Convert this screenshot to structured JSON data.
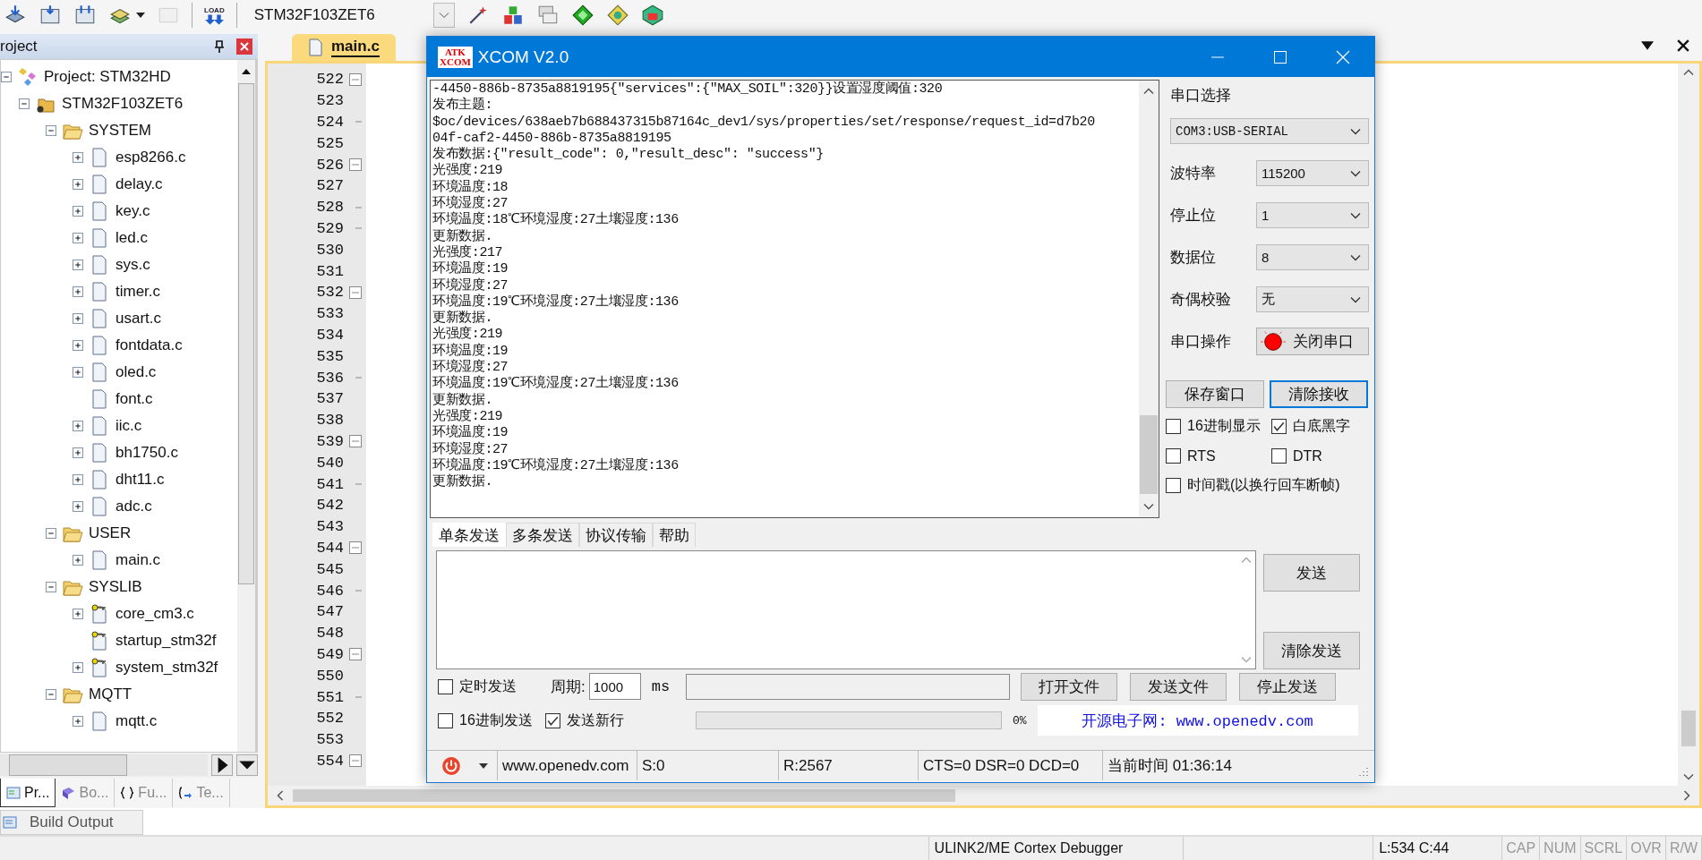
{
  "toolbar": {
    "load_label": "LOAD",
    "target": "STM32F103ZET6"
  },
  "project_panel": {
    "title": "roject",
    "tree": [
      {
        "label": "Project: STM32HD",
        "kind": "project",
        "expanded": true,
        "children": [
          {
            "label": "STM32F103ZET6",
            "kind": "target",
            "expanded": true,
            "children": [
              {
                "label": "SYSTEM",
                "kind": "group",
                "expanded": true,
                "children": [
                  {
                    "label": "esp8266.c",
                    "kind": "file",
                    "expanded": false
                  },
                  {
                    "label": "delay.c",
                    "kind": "file",
                    "expanded": false
                  },
                  {
                    "label": "key.c",
                    "kind": "file",
                    "expanded": false
                  },
                  {
                    "label": "led.c",
                    "kind": "file",
                    "expanded": false
                  },
                  {
                    "label": "sys.c",
                    "kind": "file",
                    "expanded": false
                  },
                  {
                    "label": "timer.c",
                    "kind": "file",
                    "expanded": false
                  },
                  {
                    "label": "usart.c",
                    "kind": "file",
                    "expanded": false
                  },
                  {
                    "label": "fontdata.c",
                    "kind": "file",
                    "expanded": false
                  },
                  {
                    "label": "oled.c",
                    "kind": "file",
                    "expanded": false
                  },
                  {
                    "label": "font.c",
                    "kind": "file"
                  },
                  {
                    "label": "iic.c",
                    "kind": "file",
                    "expanded": false
                  },
                  {
                    "label": "bh1750.c",
                    "kind": "file",
                    "expanded": false
                  },
                  {
                    "label": "dht11.c",
                    "kind": "file",
                    "expanded": false
                  },
                  {
                    "label": "adc.c",
                    "kind": "file",
                    "expanded": false
                  }
                ]
              },
              {
                "label": "USER",
                "kind": "group",
                "expanded": true,
                "children": [
                  {
                    "label": "main.c",
                    "kind": "file",
                    "expanded": false
                  }
                ]
              },
              {
                "label": "SYSLIB",
                "kind": "group",
                "expanded": true,
                "children": [
                  {
                    "label": "core_cm3.c",
                    "kind": "lib",
                    "expanded": false
                  },
                  {
                    "label": "startup_stm32f",
                    "kind": "lib"
                  },
                  {
                    "label": "system_stm32f",
                    "kind": "lib",
                    "expanded": false
                  }
                ]
              },
              {
                "label": "MQTT",
                "kind": "group",
                "expanded": true,
                "children": [
                  {
                    "label": "mqtt.c",
                    "kind": "file",
                    "expanded": false
                  }
                ]
              }
            ]
          }
        ]
      }
    ],
    "tabs": [
      {
        "label": "Pr...",
        "kind": "project",
        "selected": true
      },
      {
        "label": "Bo...",
        "kind": "books",
        "selected": false
      },
      {
        "label": "Fu...",
        "kind": "functions",
        "selected": false
      },
      {
        "label": "Te...",
        "kind": "templates",
        "selected": false
      }
    ]
  },
  "editor": {
    "tabs": [
      {
        "label": "main.c",
        "selected": true
      }
    ],
    "lines": [
      {
        "number": "522",
        "kind": "fold"
      },
      {
        "number": "523",
        "kind": "plain"
      },
      {
        "number": "524",
        "kind": "tick"
      },
      {
        "number": "525",
        "kind": "plain"
      },
      {
        "number": "526",
        "kind": "fold"
      },
      {
        "number": "527",
        "kind": "plain"
      },
      {
        "number": "528",
        "kind": "tick"
      },
      {
        "number": "529",
        "kind": "tick"
      },
      {
        "number": "530",
        "kind": "plain"
      },
      {
        "number": "531",
        "kind": "plain"
      },
      {
        "number": "532",
        "kind": "fold"
      },
      {
        "number": "533",
        "kind": "plain"
      },
      {
        "number": "534",
        "kind": "plain"
      },
      {
        "number": "535",
        "kind": "plain"
      },
      {
        "number": "536",
        "kind": "tick"
      },
      {
        "number": "537",
        "kind": "plain"
      },
      {
        "number": "538",
        "kind": "plain"
      },
      {
        "number": "539",
        "kind": "fold"
      },
      {
        "number": "540",
        "kind": "plain"
      },
      {
        "number": "541",
        "kind": "tick"
      },
      {
        "number": "542",
        "kind": "plain"
      },
      {
        "number": "543",
        "kind": "plain"
      },
      {
        "number": "544",
        "kind": "fold"
      },
      {
        "number": "545",
        "kind": "plain"
      },
      {
        "number": "546",
        "kind": "tick"
      },
      {
        "number": "547",
        "kind": "plain"
      },
      {
        "number": "548",
        "kind": "plain"
      },
      {
        "number": "549",
        "kind": "fold"
      },
      {
        "number": "550",
        "kind": "plain"
      },
      {
        "number": "551",
        "kind": "tick"
      },
      {
        "number": "552",
        "kind": "plain"
      },
      {
        "number": "553",
        "kind": "plain"
      },
      {
        "number": "554",
        "kind": "fold"
      }
    ]
  },
  "bottom_tabs": [
    {
      "label": "Build Output"
    }
  ],
  "status_bar": {
    "debugger": "ULINK2/ME Cortex Debugger",
    "position": "L:534 C:44",
    "indicators": [
      {
        "label": "CAP",
        "on": false
      },
      {
        "label": "NUM",
        "on": false
      },
      {
        "label": "SCRL",
        "on": false
      },
      {
        "label": "OVR",
        "on": false
      },
      {
        "label": "R/W",
        "on": false
      }
    ]
  },
  "xcom": {
    "logo_top": "ATK",
    "logo_bottom": "XCOM",
    "title": "XCOM V2.0",
    "log": [
      "-4450-886b-8735a8819195{\"services\":{\"MAX_SOIL\":320}}设置湿度阈值:320",
      "发布主题:",
      "$oc/devices/638aeb7b688437315b87164c_dev1/sys/properties/set/response/request_id=d7b20",
      "04f-caf2-4450-886b-8735a8819195",
      "发布数据:{\"result_code\": 0,\"result_desc\": \"success\"}",
      "光强度:219",
      "环境温度:18",
      "环境湿度:27",
      "环境温度:18℃环境湿度:27土壤湿度:136",
      "更新数据.",
      "光强度:217",
      "环境温度:19",
      "环境湿度:27",
      "环境温度:19℃环境湿度:27土壤湿度:136",
      "更新数据.",
      "光强度:219",
      "环境温度:19",
      "环境湿度:27",
      "环境温度:19℃环境湿度:27土壤湿度:136",
      "更新数据.",
      "光强度:219",
      "环境温度:19",
      "环境湿度:27",
      "环境温度:19℃环境湿度:27土壤湿度:136",
      "更新数据."
    ],
    "port_label": "串口选择",
    "port": "COM3:USB-SERIAL",
    "fields": [
      {
        "label": "波特率",
        "value": "115200"
      },
      {
        "label": "停止位",
        "value": "1"
      },
      {
        "label": "数据位",
        "value": "8"
      },
      {
        "label": "奇偶校验",
        "value": "无"
      }
    ],
    "operation_label": "串口操作",
    "operation_button": "关闭串口",
    "buttons": [
      {
        "label": "保存窗口",
        "focused": false
      },
      {
        "label": "清除接收",
        "focused": true
      }
    ],
    "options": [
      {
        "label": "16进制显示",
        "checked": false
      },
      {
        "label": "白底黑字",
        "checked": true
      },
      {
        "label": "RTS",
        "checked": false
      },
      {
        "label": "DTR",
        "checked": false
      },
      {
        "label": "时间戳(以换行回车断帧)",
        "checked": false
      }
    ],
    "send_tabs": [
      {
        "label": "单条发送",
        "selected": true
      },
      {
        "label": "多条发送",
        "selected": false
      },
      {
        "label": "协议传输",
        "selected": false
      },
      {
        "label": "帮助",
        "selected": false
      }
    ],
    "send_buttons": [
      "发送",
      "清除发送"
    ],
    "timed": {
      "label": "定时发送",
      "checked": false
    },
    "period_label": "周期:",
    "period": "1000",
    "unit": "ms",
    "file_buttons": [
      "打开文件",
      "发送文件",
      "停止发送"
    ],
    "hex_send": {
      "label": "16进制发送",
      "checked": false
    },
    "new_line": {
      "label": "发送新行",
      "checked": true
    },
    "progress": {
      "level": 0,
      "reading": "0%"
    },
    "link": "开源电子网: www.openedv.com",
    "status": [
      "www.openedv.com",
      "S:0",
      "R:2567",
      "CTS=0 DSR=0 DCD=0",
      "当前时间 01:36:14"
    ]
  }
}
